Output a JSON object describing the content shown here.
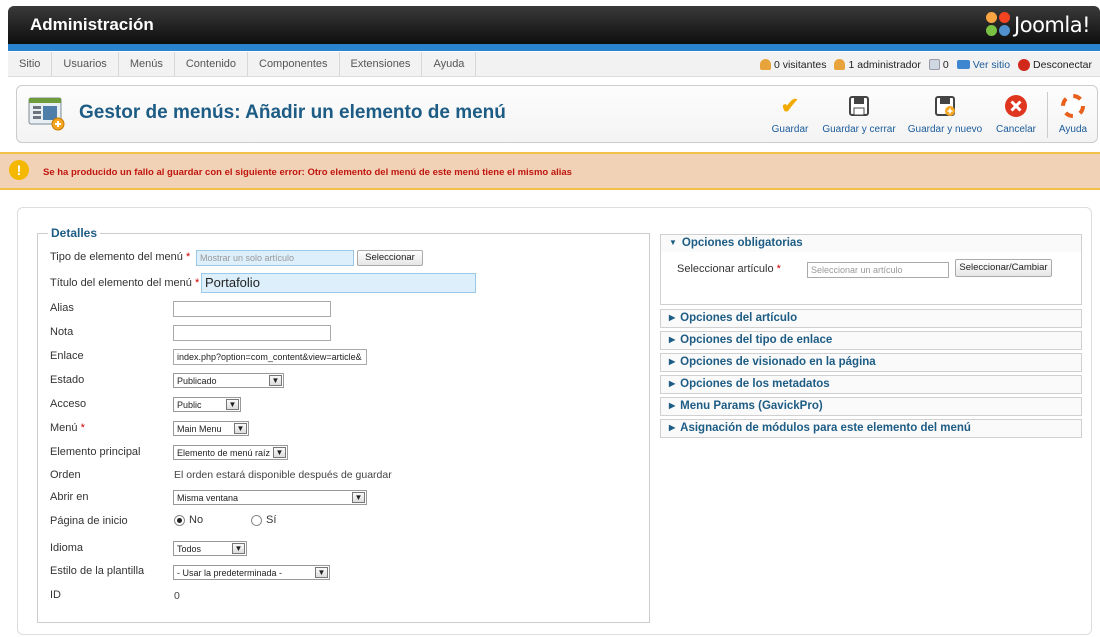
{
  "header": {
    "title": "Administración",
    "logo_text": "Joomla!"
  },
  "menu": {
    "items": [
      "Sitio",
      "Usuarios",
      "Menús",
      "Contenido",
      "Componentes",
      "Extensiones",
      "Ayuda"
    ]
  },
  "status": {
    "visitors": "0 visitantes",
    "admins": "1 administrador",
    "messages": "0",
    "view_site": "Ver sitio",
    "logout": "Desconectar"
  },
  "toolbar": {
    "title": "Gestor de menús: Añadir un elemento de menú",
    "save": "Guardar",
    "save_close": "Guardar y cerrar",
    "save_new": "Guardar y nuevo",
    "cancel": "Cancelar",
    "help": "Ayuda"
  },
  "error": {
    "message": "Se ha producido un fallo al guardar con el siguiente error: Otro elemento del menú de este menú tiene el mismo alias"
  },
  "details": {
    "legend": "Detalles",
    "type_label": "Tipo de elemento del menú",
    "type_value": "Mostrar un solo artículo",
    "select_button": "Seleccionar",
    "title_label": "Título del elemento del menú",
    "title_value": "Portafolio",
    "alias_label": "Alias",
    "alias_value": "",
    "note_label": "Nota",
    "note_value": "",
    "link_label": "Enlace",
    "link_value": "index.php?option=com_content&view=article&",
    "state_label": "Estado",
    "state_value": "Publicado",
    "access_label": "Acceso",
    "access_value": "Public",
    "menu_label": "Menú",
    "menu_value": "Main Menu",
    "parent_label": "Elemento principal",
    "parent_value": "Elemento de menú raíz",
    "order_label": "Orden",
    "order_value": "El orden estará disponible después de guardar",
    "open_label": "Abrir en",
    "open_value": "Misma ventana",
    "home_label": "Página de inicio",
    "home_no": "No",
    "home_yes": "Sí",
    "language_label": "Idioma",
    "language_value": "Todos",
    "template_label": "Estilo de la plantilla",
    "template_value": "- Usar la predeterminada -",
    "id_label": "ID",
    "id_value": "0",
    "required_mark": "*"
  },
  "panels": {
    "mandatory": "Opciones obligatorias",
    "select_article_label": "Seleccionar artículo",
    "select_article_placeholder": "Seleccionar un artículo",
    "select_change_button": "Seleccionar/Cambiar",
    "items": [
      "Opciones del artículo",
      "Opciones del tipo de enlace",
      "Opciones de visionado en la página",
      "Opciones de los metadatos",
      "Menu Params (GavickPro)",
      "Asignación de módulos para este elemento del menú"
    ]
  },
  "colors": {
    "accent": "#1d5c84",
    "error": "#c0150e",
    "bluebar": "#2a83cf"
  }
}
